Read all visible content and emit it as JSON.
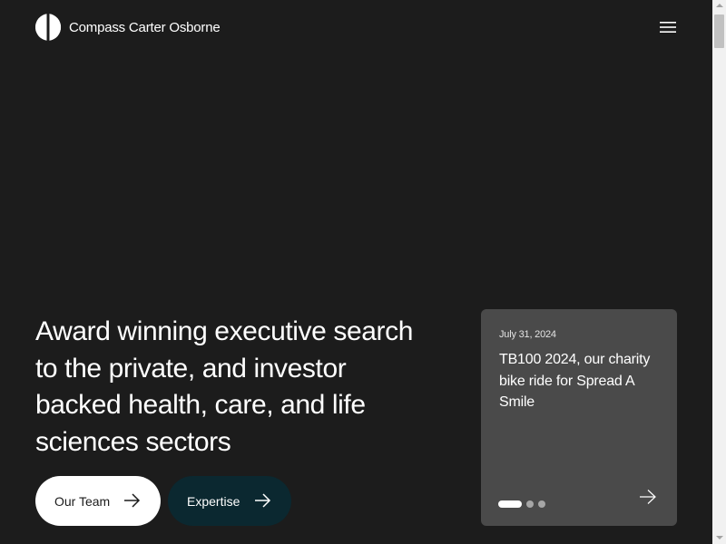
{
  "header": {
    "logo_icon": "half-circle-logo-icon",
    "brand_name": "Compass Carter Osborne",
    "menu_icon": "hamburger-menu-icon"
  },
  "hero": {
    "headline": "Award winning executive search to the private, and investor backed health, care, and life sciences sectors",
    "buttons": [
      {
        "label": "Our Team",
        "icon": "arrow-right-icon"
      },
      {
        "label": "Expertise",
        "icon": "arrow-right-icon"
      }
    ]
  },
  "news_card": {
    "date": "July 31, 2024",
    "title": "TB100 2024, our charity bike ride for Spread A Smile",
    "slides_total": 3,
    "active_slide": 1,
    "next_icon": "arrow-right-icon"
  },
  "colors": {
    "background": "#1c1c1c",
    "card_background": "#4a4a4a",
    "primary_button": "#ffffff",
    "secondary_button": "#0b2830"
  }
}
